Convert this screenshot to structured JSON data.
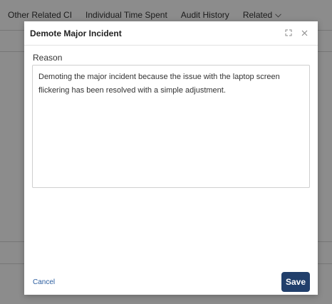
{
  "background": {
    "tabs": [
      {
        "label": "Other Related CI"
      },
      {
        "label": "Individual Time Spent"
      },
      {
        "label": "Audit History"
      },
      {
        "label": "Related",
        "has_chevron": true,
        "icon": "chevron-down-icon"
      }
    ]
  },
  "modal": {
    "title": "Demote Major Incident",
    "header_icons": [
      "expand-icon",
      "close-icon"
    ],
    "reason": {
      "label": "Reason",
      "value": "Demoting the major incident because the issue with the laptop screen flickering has been resolved with a simple adjustment."
    },
    "cancel_label": "Cancel",
    "save_label": "Save"
  },
  "colors": {
    "save_button": "#213f6b",
    "cancel_link": "#2a5d9f",
    "overlay": "rgba(0,0,0,0.45)"
  }
}
